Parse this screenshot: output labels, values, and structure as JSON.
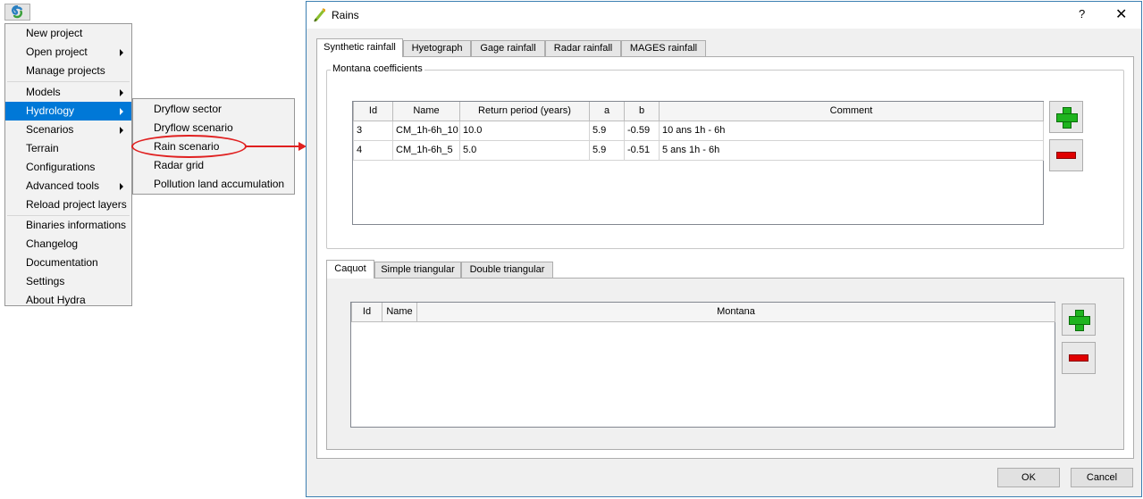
{
  "menu": {
    "items": [
      {
        "label": "New project",
        "submenu": false
      },
      {
        "label": "Open project",
        "submenu": true
      },
      {
        "label": "Manage projects",
        "submenu": false
      },
      {
        "label": "Models",
        "submenu": true
      },
      {
        "label": "Hydrology",
        "submenu": true,
        "active": true
      },
      {
        "label": "Scenarios",
        "submenu": true
      },
      {
        "label": "Terrain",
        "submenu": false
      },
      {
        "label": "Configurations",
        "submenu": false
      },
      {
        "label": "Advanced tools",
        "submenu": true
      },
      {
        "label": "Reload project layers",
        "submenu": false
      },
      {
        "label": "Binaries informations",
        "submenu": false
      },
      {
        "label": "Changelog",
        "submenu": false
      },
      {
        "label": "Documentation",
        "submenu": false
      },
      {
        "label": "Settings",
        "submenu": false
      },
      {
        "label": "About Hydra",
        "submenu": false
      }
    ]
  },
  "hydrology_submenu": {
    "items": [
      {
        "label": "Dryflow sector"
      },
      {
        "label": "Dryflow scenario"
      },
      {
        "label": "Rain scenario"
      },
      {
        "label": "Radar grid"
      },
      {
        "label": "Pollution land accumulation"
      }
    ]
  },
  "dialog": {
    "title": "Rains",
    "help": "?",
    "close": "✕",
    "tabs": [
      "Synthetic rainfall",
      "Hyetograph",
      "Gage rainfall",
      "Radar rainfall",
      "MAGES rainfall"
    ],
    "montana_group": {
      "title": "Montana coefficients",
      "columns": [
        "Id",
        "Name",
        "Return period (years)",
        "a",
        "b",
        "Comment"
      ],
      "rows": [
        [
          "3",
          "CM_1h-6h_10",
          "10.0",
          "5.9",
          "-0.59",
          "10 ans 1h - 6h"
        ],
        [
          "4",
          "CM_1h-6h_5",
          "5.0",
          "5.9",
          "-0.51",
          "5 ans 1h - 6h"
        ]
      ]
    },
    "lower_tabs": [
      "Caquot",
      "Simple triangular",
      "Double triangular"
    ],
    "caquot_table": {
      "columns": [
        "Id",
        "Name",
        "Montana"
      ]
    },
    "ok_label": "OK",
    "cancel_label": "Cancel"
  },
  "colors": {
    "menu_highlight": "#0078d7",
    "annotation": "#e02020",
    "add": "#1fb41f",
    "remove": "#e00000"
  }
}
